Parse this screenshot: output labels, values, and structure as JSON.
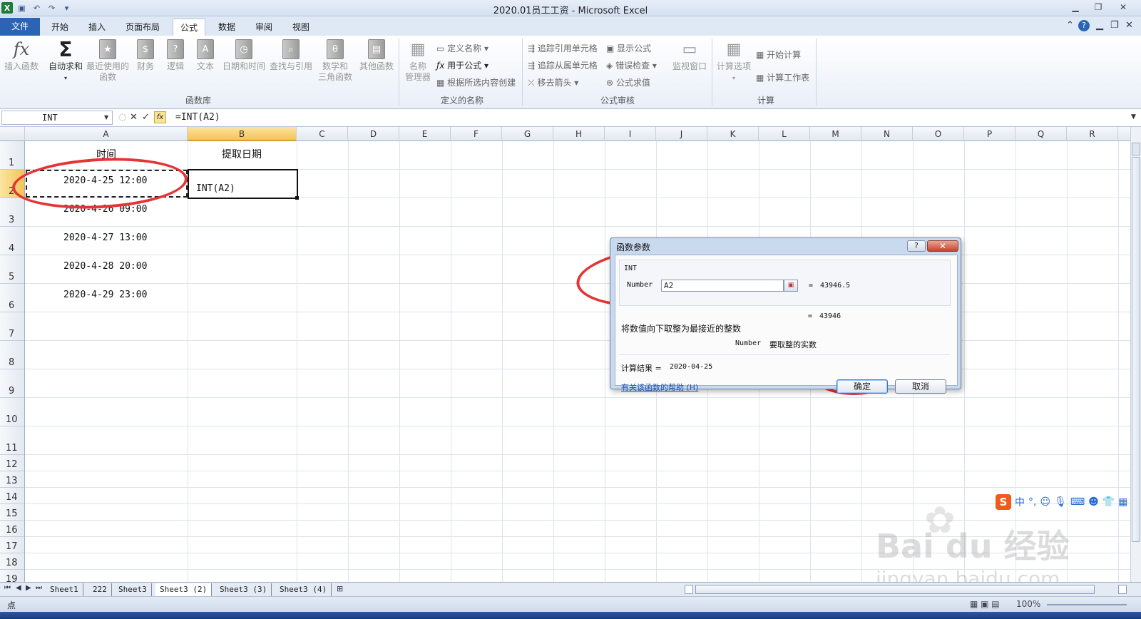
{
  "window": {
    "title": "2020.01员工工资 - Microsoft Excel"
  },
  "tabs": [
    {
      "label": "文件"
    },
    {
      "label": "开始"
    },
    {
      "label": "插入"
    },
    {
      "label": "页面布局"
    },
    {
      "label": "公式"
    },
    {
      "label": "数据"
    },
    {
      "label": "审阅"
    },
    {
      "label": "视图"
    }
  ],
  "ribbon": {
    "insert_function": "插入函数",
    "autosum": "自动求和",
    "recent_1": "最近使用的",
    "recent_2": "函数",
    "financial": "财务",
    "logical": "逻辑",
    "text": "文本",
    "datetime": "日期和时间",
    "lookup": "查找与引用",
    "math_1": "数学和",
    "math_2": "三角函数",
    "more": "其他函数",
    "group_library": "函数库",
    "name_mgr_1": "名称",
    "name_mgr_2": "管理器",
    "define_name": "定义名称",
    "use_in_formula": "用于公式",
    "create_from_sel": "根据所选内容创建",
    "group_names": "定义的名称",
    "trace_precedents": "追踪引用单元格",
    "trace_dependents": "追踪从属单元格",
    "remove_arrows": "移去箭头",
    "show_formulas": "显示公式",
    "error_check": "错误检查",
    "evaluate": "公式求值",
    "watch": "监视窗口",
    "group_audit": "公式审核",
    "calc_options": "计算选项",
    "calc_now": "开始计算",
    "calc_sheet": "计算工作表",
    "group_calc": "计算"
  },
  "formula_bar": {
    "name_box": "INT",
    "formula": "=INT(A2)"
  },
  "columns": [
    "A",
    "B",
    "C",
    "D",
    "E",
    "F",
    "G",
    "H",
    "I",
    "J",
    "K",
    "L",
    "M",
    "N",
    "O",
    "P",
    "Q",
    "R"
  ],
  "rows": [
    "1",
    "2",
    "3",
    "4",
    "5",
    "6",
    "7",
    "8",
    "9",
    "10",
    "11",
    "12",
    "13",
    "14",
    "15",
    "16",
    "17",
    "18",
    "19"
  ],
  "cells": {
    "A1": "时间",
    "B1": "提取日期",
    "A2": "2020-4-25 12:00",
    "B2": "INT(A2)",
    "A3": "2020-4-26 09:00",
    "A4": "2020-4-27 13:00",
    "A5": "2020-4-28 20:00",
    "A6": "2020-4-29 23:00"
  },
  "sheets": [
    "Sheet1",
    "222",
    "Sheet3",
    "Sheet3 (2)",
    "Sheet3 (3)",
    "Sheet3 (4)"
  ],
  "status": {
    "mode": "点",
    "zoom": "100%"
  },
  "dialog": {
    "title": "函数参数",
    "help_glyph": "?",
    "close_glyph": "✕",
    "function_name": "INT",
    "arg_label": "Number",
    "arg_value": "A2",
    "arg_eval": "43946.5",
    "result_eval": "43946",
    "equals": "=",
    "description": "将数值向下取整为最接近的整数",
    "arg_desc_name": "Number",
    "arg_desc": "要取整的实数",
    "calc_result_label": "计算结果 =",
    "calc_result_value": "2020-04-25",
    "help_link": "有关该函数的帮助 (H)",
    "ok": "确定",
    "cancel": "取消"
  },
  "ime": {
    "logo": "S",
    "mode": "中"
  },
  "watermark": {
    "brand": "Bai du 经验",
    "url": "jingyan.baidu.com"
  },
  "colors": {
    "annotation_red": "#e43435",
    "file_tab": "#2a64b3",
    "selection_header": "#f5c356"
  }
}
